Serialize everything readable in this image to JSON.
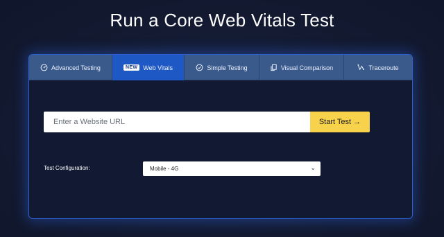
{
  "page": {
    "title": "Run a Core Web Vitals Test"
  },
  "tabs": [
    {
      "label": "Advanced Testing",
      "icon": "gauge-icon"
    },
    {
      "label": "Web Vitals",
      "icon": "",
      "badge": "NEW",
      "active": true
    },
    {
      "label": "Simple Testing",
      "icon": "check-circle-icon"
    },
    {
      "label": "Visual Comparison",
      "icon": "copy-icon"
    },
    {
      "label": "Traceroute",
      "icon": "traceroute-icon"
    }
  ],
  "search": {
    "placeholder": "Enter a Website URL",
    "button_label": "Start Test →"
  },
  "config": {
    "label": "Test Configuration:",
    "selected": "Mobile - 4G"
  },
  "colors": {
    "accent": "#1d58c4",
    "button": "#f7d24a",
    "tab_bar": "#3a5a8c",
    "panel_border": "#2e5fd1"
  }
}
